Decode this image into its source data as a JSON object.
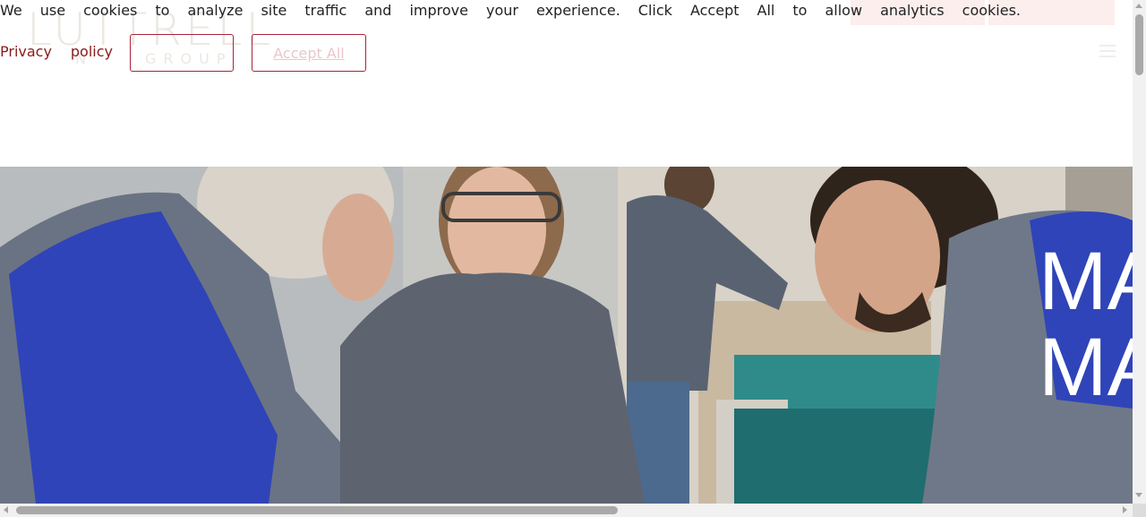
{
  "cookie_banner": {
    "message": "We use cookies to analyze site traffic and improve your experience. Click Accept All to allow analytics cookies.",
    "privacy_link": "Privacy policy",
    "decline_label": "",
    "accept_label": "Accept All",
    "accent_color": "#a8243a"
  },
  "header": {
    "logo_text": "LUTTRELL",
    "logo_sub_left": "N",
    "logo_sub": "GROUP",
    "menu_icon": "hamburger-menu-icon"
  },
  "hero": {
    "title_lines": [
      "MA",
      "MA"
    ]
  }
}
